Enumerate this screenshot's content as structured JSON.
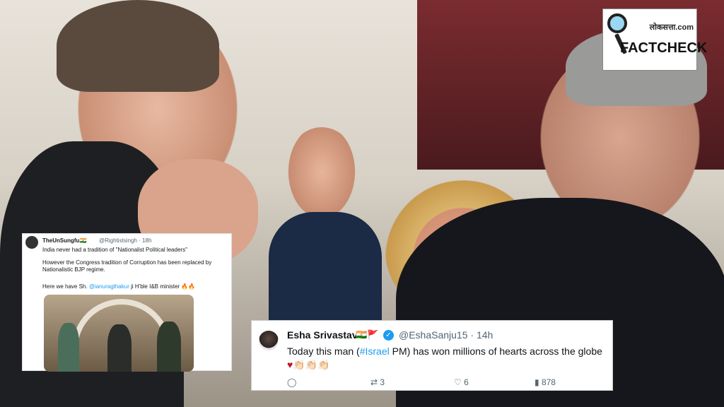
{
  "logo": {
    "site": "लोकसत्ता.com",
    "word": "FACTCHECK"
  },
  "tweet_left": {
    "name": "TheUnSungfu",
    "flag": "🇮🇳",
    "handle": "@Rightistsingh",
    "time": "· 18h",
    "line1": "India never had a tradition of \"Nationalist Political leaders\"",
    "line2a": "However the Congress tradition of Corruption has been replaced by",
    "line2b": "Nationalistic BJP regime.",
    "line3_prefix": "Here we have Sh.",
    "line3_mention": "@ianuragthakur",
    "line3_suffix": "ji H'ble I&B minister 🔥🔥"
  },
  "tweet_right": {
    "name": "Esha Srivastav",
    "flags": "🇮🇳🚩",
    "verified_symbol": "✓",
    "handle": "@EshaSanju15",
    "time": "· 14h",
    "text_prefix": "Today this man (",
    "hashtag": "#Israel",
    "text_suffix": " PM) has won millions of hearts across the globe",
    "emoji": "♥👏🏻👏🏻👏🏻",
    "actions": {
      "reply": {
        "icon": "reply-icon",
        "glyph": "◯",
        "count": ""
      },
      "retweet": {
        "icon": "retweet-icon",
        "glyph": "⇄",
        "count": "3"
      },
      "like": {
        "icon": "heart-icon",
        "glyph": "♡",
        "count": "6"
      },
      "views": {
        "icon": "views-icon",
        "glyph": "▮",
        "count": "878"
      }
    }
  }
}
